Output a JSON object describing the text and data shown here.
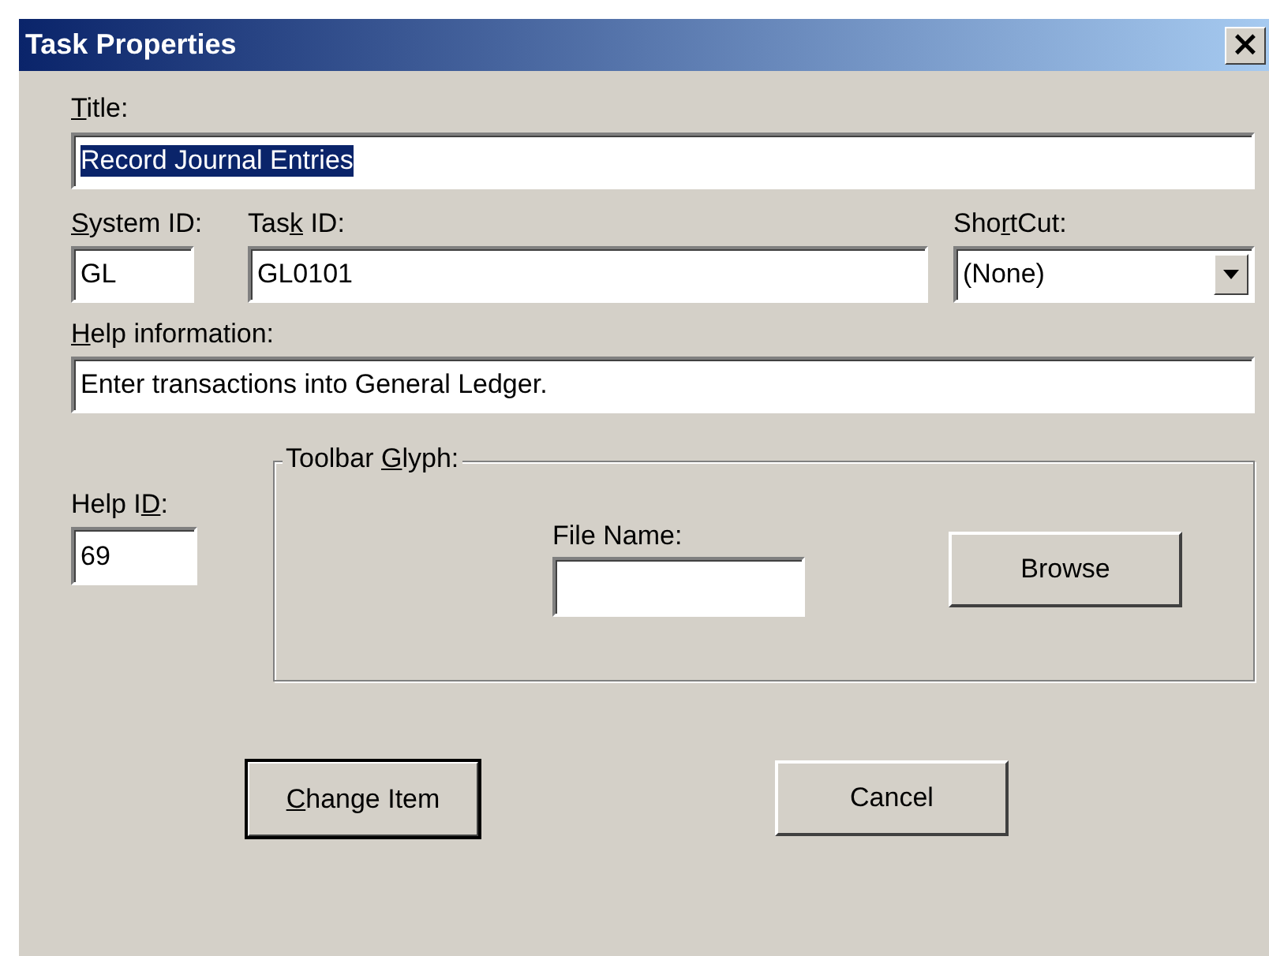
{
  "window": {
    "title": "Task Properties",
    "close": "×"
  },
  "title_field": {
    "label": {
      "key": "T",
      "post": "itle:"
    },
    "value": "Record Journal Entries",
    "selected": true
  },
  "system_id": {
    "label": {
      "key": "S",
      "post": "ystem ID:"
    },
    "value": "GL"
  },
  "task_id": {
    "label": {
      "pre": "Tas",
      "key": "k",
      "post": " ID:"
    },
    "value": "GL0101"
  },
  "shortcut": {
    "label": {
      "pre": "Sho",
      "key": "r",
      "post": "tCut:"
    },
    "value": "(None)"
  },
  "help_information": {
    "label": {
      "key": "H",
      "post": "elp information:"
    },
    "value": "Enter transactions into General Ledger."
  },
  "help_id": {
    "label": {
      "pre": "Help I",
      "key": "D",
      "post": ":"
    },
    "value": "69"
  },
  "toolbar_glyph": {
    "legend": {
      "pre": "Toolbar ",
      "key": "G",
      "post": "lyph:"
    },
    "file_name_label": "File Name:",
    "browse": "Browse"
  },
  "buttons": [
    {
      "label": {
        "key": "C",
        "post": "hange Item"
      },
      "default": true
    },
    {
      "label": {
        "post": "Cancel"
      },
      "default": false
    }
  ]
}
